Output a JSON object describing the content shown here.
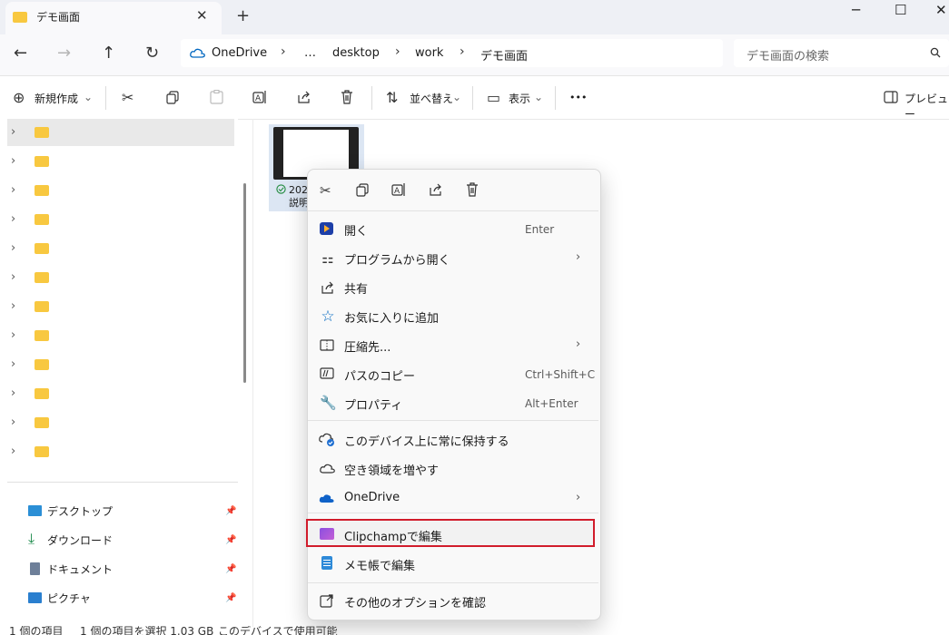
{
  "window": {
    "tab_title": "デモ画面",
    "new_tab_icon": "+",
    "close_tab_icon": "✕",
    "minimize_icon": "─",
    "maximize_icon": "☐",
    "close_icon": "✕"
  },
  "nav": {
    "back_icon": "←",
    "forward_icon": "→",
    "up_icon": "↑",
    "refresh_icon": "↻",
    "breadcrumbs": [
      "OneDrive",
      "…",
      "desktop",
      "work",
      "デモ画面"
    ],
    "search_placeholder": "デモ画面の検索"
  },
  "toolbar": {
    "new_label": "新規作成",
    "sort_label": "並べ替え",
    "view_label": "表示",
    "more_label": "•••",
    "preview_label": "プレビュー"
  },
  "sidebar": {
    "folder_rows": 12,
    "quick_access": [
      {
        "label": "デスクトップ",
        "icon": "desktop-icon"
      },
      {
        "label": "ダウンロード",
        "icon": "download-icon"
      },
      {
        "label": "ドキュメント",
        "icon": "document-icon"
      },
      {
        "label": "ピクチャ",
        "icon": "pictures-icon"
      }
    ]
  },
  "file": {
    "name_line1": "202",
    "name_line2": "説明"
  },
  "context_menu": {
    "items": [
      {
        "label": "開く",
        "shortcut": "Enter"
      },
      {
        "label": "プログラムから開く",
        "submenu": true
      },
      {
        "label": "共有"
      },
      {
        "label": "お気に入りに追加"
      },
      {
        "label": "圧縮先...",
        "submenu": true
      },
      {
        "label": "パスのコピー",
        "shortcut": "Ctrl+Shift+C"
      },
      {
        "label": "プロパティ",
        "shortcut": "Alt+Enter"
      },
      {
        "label": "このデバイス上に常に保持する"
      },
      {
        "label": "空き領域を増やす"
      },
      {
        "label": "OneDrive",
        "submenu": true
      },
      {
        "label": "Clipchampで編集",
        "highlighted": true
      },
      {
        "label": "メモ帳で編集"
      },
      {
        "label": "その他のオプションを確認"
      }
    ]
  },
  "status": {
    "items_count": "1 個の項目",
    "selected": "1 個の項目を選択 1.03 GB",
    "availability": "このデバイスで使用可能"
  },
  "colors": {
    "accent": "#0067c0",
    "highlight_border": "#d11c2b",
    "folder": "#f8c840",
    "selection": "#dce6f3"
  }
}
